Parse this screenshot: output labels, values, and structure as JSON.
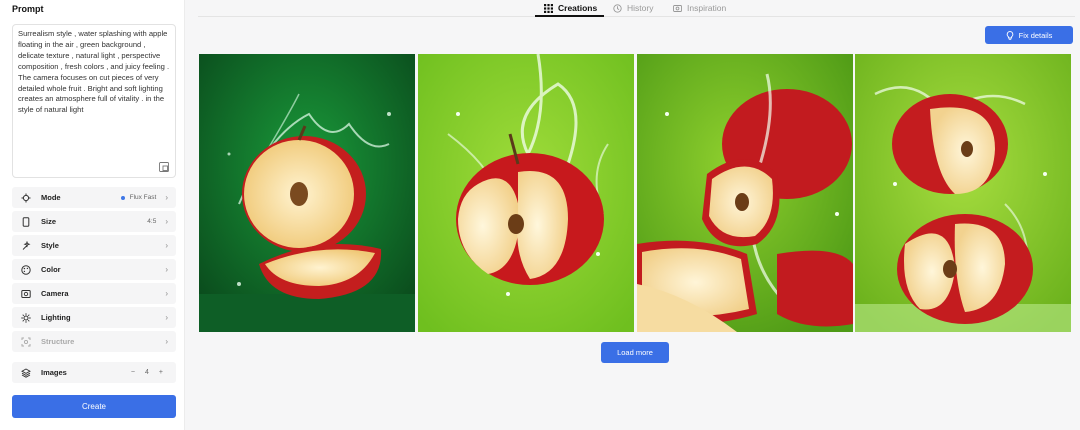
{
  "prompt": {
    "title": "Prompt",
    "text": "Surrealism style , water splashing with apple floating in the air , green background , delicate texture , natural light , perspective composition , fresh colors , and juicy feeling . The camera focuses on cut pieces of very detailed whole fruit . Bright and soft lighting creates an atmosphere full of vitality . in the style of natural light"
  },
  "options": {
    "mode": {
      "label": "Mode",
      "value": "Flux Fast"
    },
    "size": {
      "label": "Size",
      "value": "4:5"
    },
    "style": {
      "label": "Style"
    },
    "color": {
      "label": "Color"
    },
    "camera": {
      "label": "Camera"
    },
    "lighting": {
      "label": "Lighting"
    },
    "structure": {
      "label": "Structure"
    },
    "images": {
      "label": "Images",
      "value": "4",
      "minus": "−",
      "plus": "+"
    }
  },
  "create_label": "Create",
  "tabs": [
    {
      "label": "Creations",
      "icon": "grid-icon",
      "active": true
    },
    {
      "label": "History",
      "icon": "history-icon",
      "active": false
    },
    {
      "label": "Inspiration",
      "icon": "inspiration-icon",
      "active": false
    }
  ],
  "fix_details_label": "Fix details",
  "load_more_label": "Load more",
  "gallery": [
    {
      "description_icon": "apple-image"
    },
    {
      "description_icon": "apple-image"
    },
    {
      "description_icon": "apple-image"
    },
    {
      "description_icon": "apple-image"
    }
  ],
  "colors": {
    "accent": "#3a6fe6",
    "panel": "#ffffff",
    "background": "#f6f6f7"
  }
}
